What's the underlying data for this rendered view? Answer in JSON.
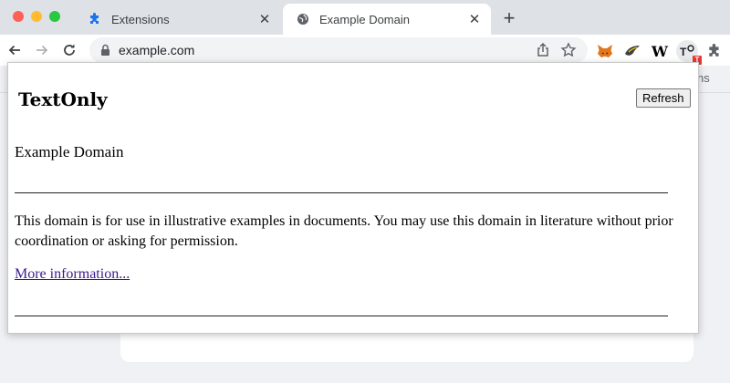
{
  "browser": {
    "tabs": [
      {
        "title": "Extensions",
        "active": false,
        "icon": "puzzle-icon"
      },
      {
        "title": "Example Domain",
        "active": true,
        "icon": "globe-icon"
      }
    ],
    "address_bar": {
      "url": "example.com"
    },
    "extensions": [
      "metamask-fox-icon",
      "bird-icon",
      "wikipedia-w-icon",
      "textonly-icon",
      "puzzle-icon"
    ],
    "bookmark_fragment": "ns"
  },
  "popup": {
    "brand": "TextOnly",
    "refresh_label": "Refresh",
    "badge": "T",
    "heading": "Example Domain",
    "body": "This domain is for use in illustrative examples in documents. You may use this domain in literature without prior coordination or asking for permission.",
    "link": "More information..."
  },
  "colors": {
    "tabstrip": "#dee1e6",
    "link": "#3b1a8b",
    "badge": "#e53935",
    "extensions_icon": "#1a73e8"
  }
}
